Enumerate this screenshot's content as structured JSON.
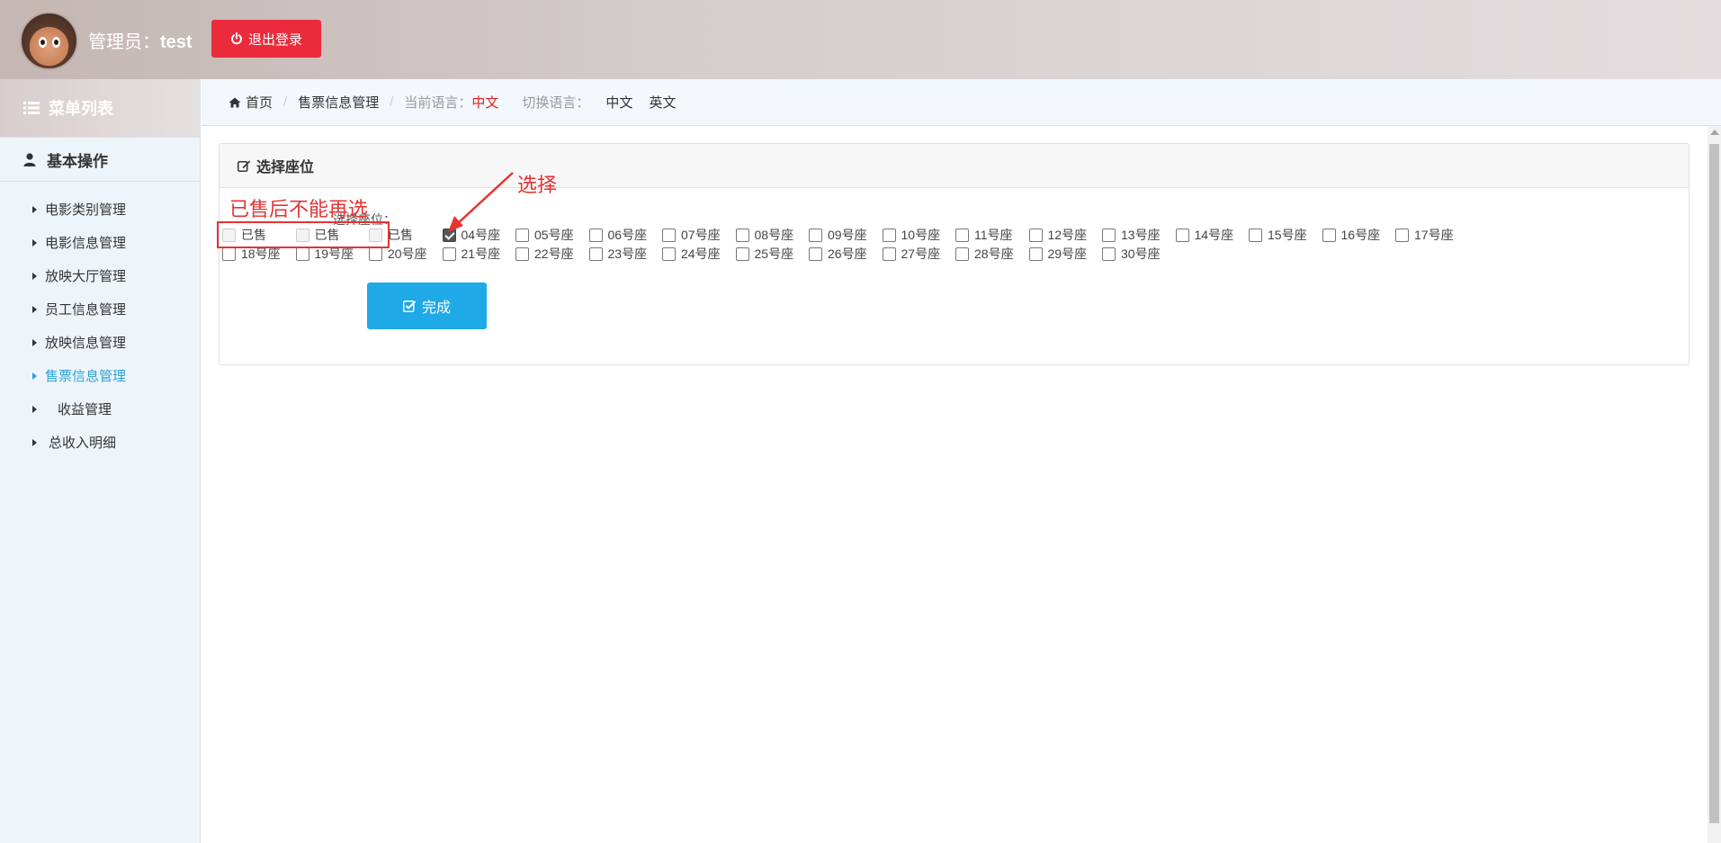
{
  "header": {
    "admin_prefix": "管理员：",
    "admin_name": "test",
    "logout_label": "退出登录"
  },
  "sidebar": {
    "menu_title": "菜单列表",
    "group_title": "基本操作",
    "items": [
      {
        "label": "电影类别管理",
        "active": false
      },
      {
        "label": "电影信息管理",
        "active": false
      },
      {
        "label": "放映大厅管理",
        "active": false
      },
      {
        "label": "员工信息管理",
        "active": false
      },
      {
        "label": "放映信息管理",
        "active": false
      },
      {
        "label": "售票信息管理",
        "active": true
      },
      {
        "label": "收益管理",
        "active": false
      },
      {
        "label": "总收入明细",
        "active": false
      }
    ]
  },
  "breadcrumb": {
    "home": "首页",
    "current": "售票信息管理",
    "current_lang_label": "当前语言：",
    "current_lang": "中文",
    "switch_label": "切换语言：",
    "lang_zh": "中文",
    "lang_en": "英文"
  },
  "panel": {
    "title": "选择座位",
    "seat_label": "选择座位：",
    "seats_row1": [
      {
        "label": "已售",
        "state": "sold"
      },
      {
        "label": "已售",
        "state": "sold"
      },
      {
        "label": "已售",
        "state": "sold"
      },
      {
        "label": "04号座",
        "state": "checked"
      },
      {
        "label": "05号座",
        "state": "free"
      },
      {
        "label": "06号座",
        "state": "free"
      },
      {
        "label": "07号座",
        "state": "free"
      },
      {
        "label": "08号座",
        "state": "free"
      },
      {
        "label": "09号座",
        "state": "free"
      },
      {
        "label": "10号座",
        "state": "free"
      },
      {
        "label": "11号座",
        "state": "free"
      },
      {
        "label": "12号座",
        "state": "free"
      },
      {
        "label": "13号座",
        "state": "free"
      },
      {
        "label": "14号座",
        "state": "free"
      },
      {
        "label": "15号座",
        "state": "free"
      },
      {
        "label": "16号座",
        "state": "free"
      },
      {
        "label": "17号座",
        "state": "free"
      }
    ],
    "seats_row2": [
      {
        "label": "18号座",
        "state": "free"
      },
      {
        "label": "19号座",
        "state": "free"
      },
      {
        "label": "20号座",
        "state": "free"
      },
      {
        "label": "21号座",
        "state": "free"
      },
      {
        "label": "22号座",
        "state": "free"
      },
      {
        "label": "23号座",
        "state": "free"
      },
      {
        "label": "24号座",
        "state": "free"
      },
      {
        "label": "25号座",
        "state": "free"
      },
      {
        "label": "26号座",
        "state": "free"
      },
      {
        "label": "27号座",
        "state": "free"
      },
      {
        "label": "28号座",
        "state": "free"
      },
      {
        "label": "29号座",
        "state": "free"
      },
      {
        "label": "30号座",
        "state": "free"
      }
    ],
    "done_label": "完成"
  },
  "annotations": {
    "sold_note": "已售后不能再选",
    "select_note": "选择",
    "color": "#e53333"
  },
  "colors": {
    "logout": "#ea2b3b",
    "active_menu": "#2aa3d9",
    "done_button": "#1fa9e7",
    "current_lang": "#e02020"
  }
}
